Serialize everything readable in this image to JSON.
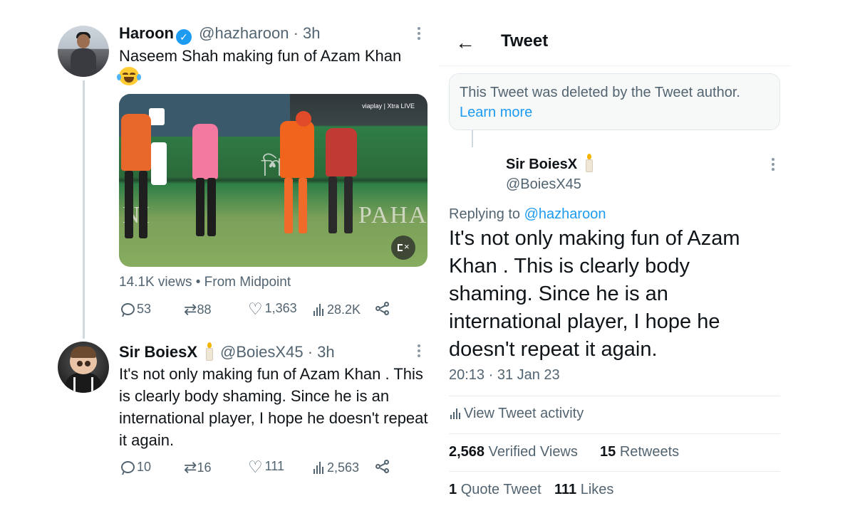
{
  "tweet1": {
    "name": "Haroon",
    "handle": "@hazharoon",
    "time": "· 3h",
    "text": "Naseem Shah making fun of Azam Khan",
    "emoji": "face-with-tears-of-joy",
    "video": {
      "overlay_logo": "viaplay | Xtra LIVE",
      "board_text_1": "NI",
      "board_text_2": "PAHAN"
    },
    "views_line": "14.1K views",
    "source": "From Midpoint",
    "replies": "53",
    "retweets": "88",
    "likes": "1,363",
    "view_count": "28.2K"
  },
  "tweet2": {
    "name": "Sir BoiesX",
    "handle": "@BoiesX45",
    "time": "· 3h",
    "text": "It's not only making fun of Azam Khan . This is clearly body shaming. Since he is an international player, I hope he doesn't repeat it again.",
    "replies": "10",
    "retweets": "16",
    "likes": "111",
    "view_count": "2,563"
  },
  "detail": {
    "header_title": "Tweet",
    "deleted_notice": "This Tweet was deleted by the Tweet author.",
    "learn_more": "Learn more",
    "name": "Sir BoiesX",
    "handle": "@BoiesX45",
    "replying_label": "Replying to",
    "replying_to": "@hazharoon",
    "text": "It's not only making fun of Azam Khan . This is clearly body shaming. Since he is an international player, I hope he doesn't repeat it again.",
    "timestamp": "20:13 · 31 Jan 23",
    "activity_label": "View Tweet activity",
    "verified_views_count": "2,568",
    "verified_views_label": "Verified Views",
    "retweets_count": "15",
    "retweets_label": "Retweets",
    "quote_count": "1",
    "quote_label": "Quote Tweet",
    "likes_count": "111",
    "likes_label": "Likes"
  },
  "colors": {
    "accent": "#1d9bf0",
    "text_primary": "#0f1419",
    "text_secondary": "#536471"
  }
}
